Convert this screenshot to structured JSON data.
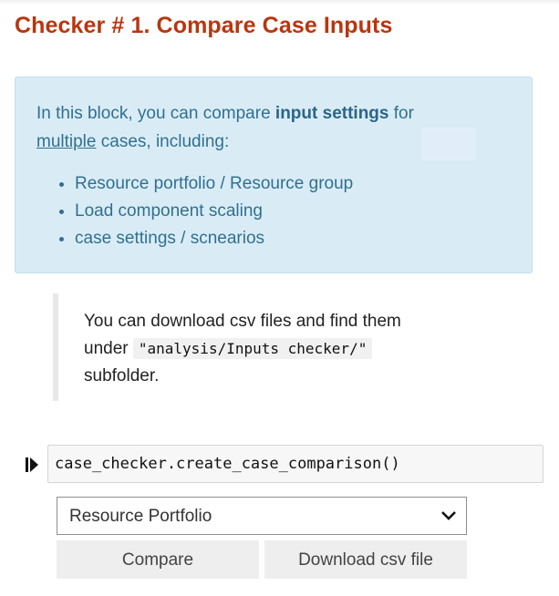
{
  "header": {
    "title": "Checker # 1. Compare Case Inputs"
  },
  "info": {
    "intro_pre": "In this block, you can compare ",
    "intro_bold": "input settings",
    "intro_mid": " for",
    "intro_underline": "multiple",
    "intro_post": " cases, including:",
    "bullets": [
      "Resource portfolio / Resource group",
      "Load component scaling",
      "case settings / scnearios"
    ]
  },
  "note": {
    "line1": "You can download csv files and find them",
    "under": "under ",
    "path": "\"analysis/Inputs checker/\"",
    "line3": "subfolder."
  },
  "cell": {
    "code": "case_checker.create_case_comparison()"
  },
  "widget": {
    "select_value": "Resource Portfolio",
    "compare_label": "Compare",
    "download_label": "Download csv file"
  },
  "icons": {
    "run": "run-cell-icon",
    "dropdown": "chevron-down-icon"
  }
}
